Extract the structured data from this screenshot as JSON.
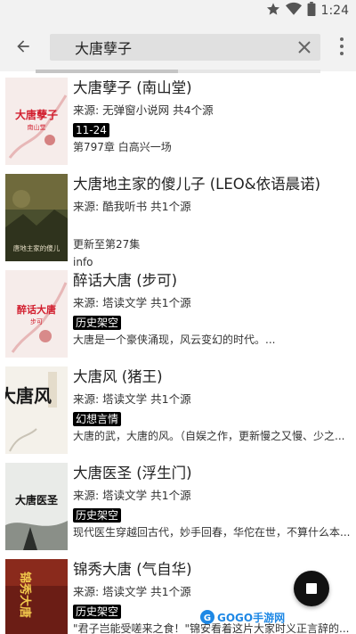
{
  "status_bar": {
    "time": "1:24",
    "icons": [
      "star-icon",
      "wifi-icon",
      "battery-icon"
    ]
  },
  "toolbar": {
    "search_value": "大唐孽子",
    "icons": [
      "back-arrow-icon",
      "clear-icon",
      "more-vert-icon"
    ]
  },
  "progress": {
    "fraction": 0.5
  },
  "books": [
    {
      "title": "大唐孽子 (南山堂)",
      "source": "来源:     无弹窗小说网  共4个源",
      "tag": "11-24",
      "extra": "第797章 白高兴一场",
      "info": "",
      "cover": {
        "text": "大唐孽子",
        "sub": "南山堂",
        "bg": "#f6ecea",
        "accent": "#d21f2f"
      }
    },
    {
      "title": "大唐地主家的傻儿子 (LEO&依语晨诺)",
      "source": "来源: 酷我听书  共1个源",
      "tag": "",
      "extra": "更新至第27集",
      "info": "info",
      "cover": {
        "text": "唐地主家的傻儿",
        "sub": "",
        "bg": "#4a4f2e",
        "accent": "#e8e0c8"
      }
    },
    {
      "title": "醉话大唐 (步可)",
      "source": "来源: 塔读文学  共1个源",
      "tag": "历史架空",
      "extra": "大唐是一个豪侠涌现，风云变幻的时代。...",
      "info": "",
      "cover": {
        "text": "醉话大唐",
        "sub": "步可",
        "bg": "#f6ecea",
        "accent": "#d21f2f"
      }
    },
    {
      "title": "大唐风 (猪王)",
      "source": "来源: 塔读文学  共1个源",
      "tag": "幻想言情",
      "extra": "大唐的武，大唐的风。（自娱之作，更新慢之又慢、少之...",
      "info": "",
      "cover": {
        "text": "大唐风",
        "sub": "",
        "bg": "#f4f1ea",
        "accent": "#1a1a1a"
      }
    },
    {
      "title": "大唐医圣 (浮生门)",
      "source": "来源: 塔读文学  共1个源",
      "tag": "历史架空",
      "extra": "现代医生穿越回古代，妙手回春，华佗在世，不算什么本...",
      "info": "",
      "cover": {
        "text": "大唐医圣",
        "sub": "",
        "bg": "#e9ebe8",
        "accent": "#111111"
      }
    },
    {
      "title": "锦秀大唐 (气自华)",
      "source": "来源: 塔读文学  共1个源",
      "tag": "历史架空",
      "extra": "\"君子岂能受嗟来之食！\"锦安看着这片大家时义正言辞的...",
      "info": "",
      "cover": {
        "text": "锦秀大唐",
        "sub": "",
        "bg": "#6b1d15",
        "accent": "#f2c94c"
      }
    }
  ],
  "watermark": {
    "text": "GOGO手游网"
  }
}
